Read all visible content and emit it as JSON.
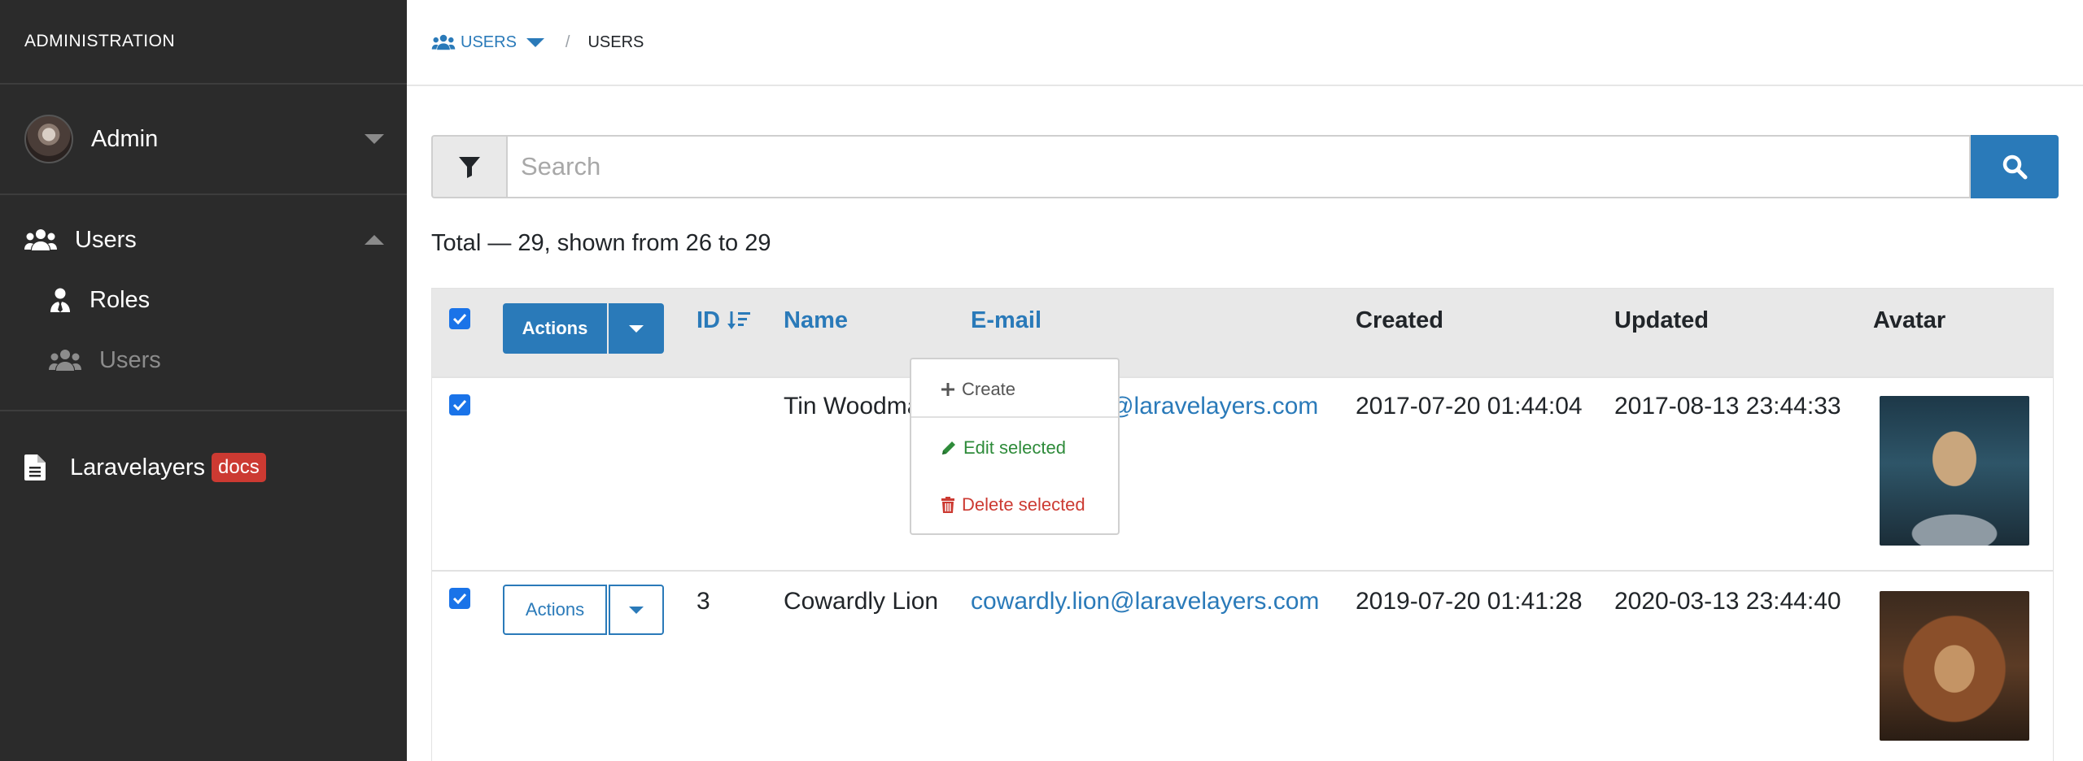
{
  "sidebar": {
    "brand": "ADMINISTRATION",
    "user": {
      "name": "Admin"
    },
    "nav": {
      "users_label": "Users",
      "roles_label": "Roles",
      "users_sub_label": "Users"
    },
    "docs": {
      "label": "Laravelayers",
      "badge": "docs"
    }
  },
  "breadcrumb": {
    "section": "USERS",
    "current": "USERS",
    "separator": "/"
  },
  "search": {
    "placeholder": "Search",
    "value": ""
  },
  "total_text": "Total — 29, shown from 26 to 29",
  "table": {
    "headers": {
      "id": "ID",
      "name": "Name",
      "email": "E-mail",
      "created": "Created",
      "updated": "Updated",
      "avatar": "Avatar"
    },
    "actions_label": "Actions",
    "rows": [
      {
        "id": "",
        "name": "Tin Woodman",
        "email": "tin.woodman@laravelayers.com",
        "created": "2017-07-20 01:44:04",
        "updated": "2017-08-13 23:44:33"
      },
      {
        "id": "3",
        "name": "Cowardly Lion",
        "email": "cowardly.lion@laravelayers.com",
        "created": "2019-07-20 01:41:28",
        "updated": "2020-03-13 23:44:40"
      }
    ]
  },
  "dropdown": {
    "create": "Create",
    "edit": "Edit selected",
    "delete": "Delete selected"
  },
  "colors": {
    "accent": "#2a7ab9",
    "sidebar_bg": "#2b2b2b",
    "success": "#2e8b3a",
    "danger": "#cc3a32"
  }
}
